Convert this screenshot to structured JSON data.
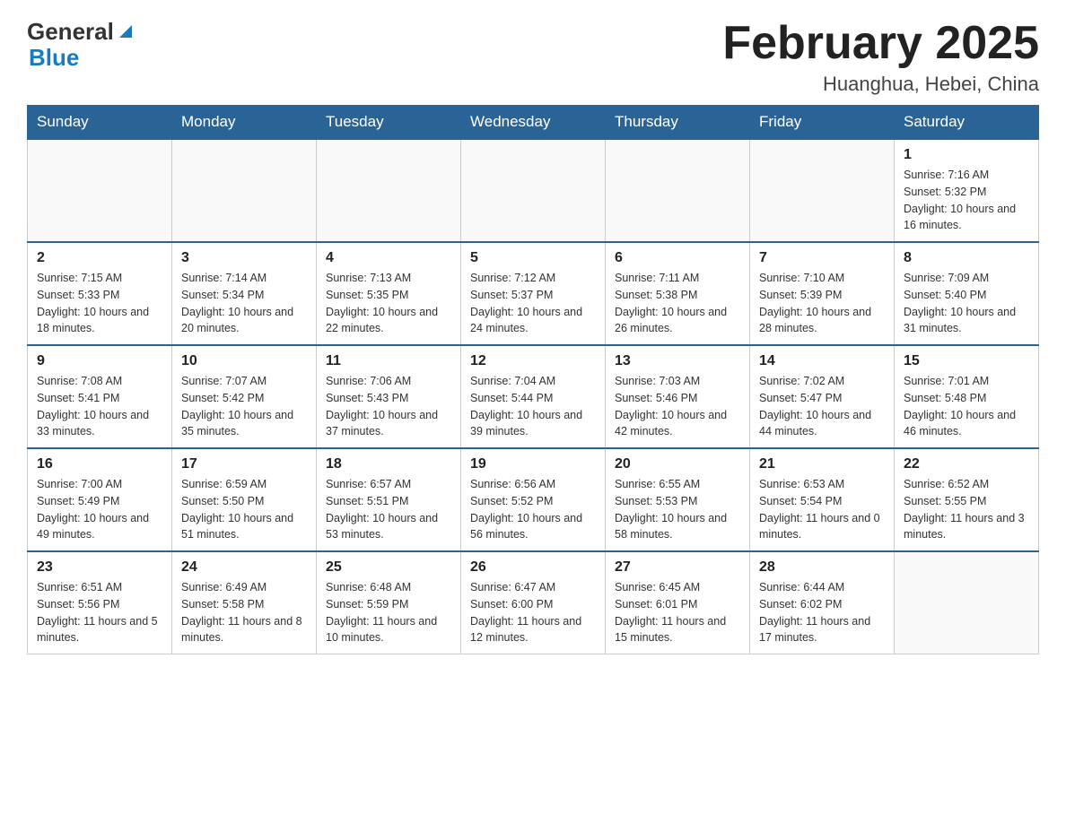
{
  "logo": {
    "general": "General",
    "arrow": "▶",
    "blue": "Blue"
  },
  "title": "February 2025",
  "location": "Huanghua, Hebei, China",
  "days_of_week": [
    "Sunday",
    "Monday",
    "Tuesday",
    "Wednesday",
    "Thursday",
    "Friday",
    "Saturday"
  ],
  "weeks": [
    [
      {
        "day": "",
        "info": ""
      },
      {
        "day": "",
        "info": ""
      },
      {
        "day": "",
        "info": ""
      },
      {
        "day": "",
        "info": ""
      },
      {
        "day": "",
        "info": ""
      },
      {
        "day": "",
        "info": ""
      },
      {
        "day": "1",
        "info": "Sunrise: 7:16 AM\nSunset: 5:32 PM\nDaylight: 10 hours and 16 minutes."
      }
    ],
    [
      {
        "day": "2",
        "info": "Sunrise: 7:15 AM\nSunset: 5:33 PM\nDaylight: 10 hours and 18 minutes."
      },
      {
        "day": "3",
        "info": "Sunrise: 7:14 AM\nSunset: 5:34 PM\nDaylight: 10 hours and 20 minutes."
      },
      {
        "day": "4",
        "info": "Sunrise: 7:13 AM\nSunset: 5:35 PM\nDaylight: 10 hours and 22 minutes."
      },
      {
        "day": "5",
        "info": "Sunrise: 7:12 AM\nSunset: 5:37 PM\nDaylight: 10 hours and 24 minutes."
      },
      {
        "day": "6",
        "info": "Sunrise: 7:11 AM\nSunset: 5:38 PM\nDaylight: 10 hours and 26 minutes."
      },
      {
        "day": "7",
        "info": "Sunrise: 7:10 AM\nSunset: 5:39 PM\nDaylight: 10 hours and 28 minutes."
      },
      {
        "day": "8",
        "info": "Sunrise: 7:09 AM\nSunset: 5:40 PM\nDaylight: 10 hours and 31 minutes."
      }
    ],
    [
      {
        "day": "9",
        "info": "Sunrise: 7:08 AM\nSunset: 5:41 PM\nDaylight: 10 hours and 33 minutes."
      },
      {
        "day": "10",
        "info": "Sunrise: 7:07 AM\nSunset: 5:42 PM\nDaylight: 10 hours and 35 minutes."
      },
      {
        "day": "11",
        "info": "Sunrise: 7:06 AM\nSunset: 5:43 PM\nDaylight: 10 hours and 37 minutes."
      },
      {
        "day": "12",
        "info": "Sunrise: 7:04 AM\nSunset: 5:44 PM\nDaylight: 10 hours and 39 minutes."
      },
      {
        "day": "13",
        "info": "Sunrise: 7:03 AM\nSunset: 5:46 PM\nDaylight: 10 hours and 42 minutes."
      },
      {
        "day": "14",
        "info": "Sunrise: 7:02 AM\nSunset: 5:47 PM\nDaylight: 10 hours and 44 minutes."
      },
      {
        "day": "15",
        "info": "Sunrise: 7:01 AM\nSunset: 5:48 PM\nDaylight: 10 hours and 46 minutes."
      }
    ],
    [
      {
        "day": "16",
        "info": "Sunrise: 7:00 AM\nSunset: 5:49 PM\nDaylight: 10 hours and 49 minutes."
      },
      {
        "day": "17",
        "info": "Sunrise: 6:59 AM\nSunset: 5:50 PM\nDaylight: 10 hours and 51 minutes."
      },
      {
        "day": "18",
        "info": "Sunrise: 6:57 AM\nSunset: 5:51 PM\nDaylight: 10 hours and 53 minutes."
      },
      {
        "day": "19",
        "info": "Sunrise: 6:56 AM\nSunset: 5:52 PM\nDaylight: 10 hours and 56 minutes."
      },
      {
        "day": "20",
        "info": "Sunrise: 6:55 AM\nSunset: 5:53 PM\nDaylight: 10 hours and 58 minutes."
      },
      {
        "day": "21",
        "info": "Sunrise: 6:53 AM\nSunset: 5:54 PM\nDaylight: 11 hours and 0 minutes."
      },
      {
        "day": "22",
        "info": "Sunrise: 6:52 AM\nSunset: 5:55 PM\nDaylight: 11 hours and 3 minutes."
      }
    ],
    [
      {
        "day": "23",
        "info": "Sunrise: 6:51 AM\nSunset: 5:56 PM\nDaylight: 11 hours and 5 minutes."
      },
      {
        "day": "24",
        "info": "Sunrise: 6:49 AM\nSunset: 5:58 PM\nDaylight: 11 hours and 8 minutes."
      },
      {
        "day": "25",
        "info": "Sunrise: 6:48 AM\nSunset: 5:59 PM\nDaylight: 11 hours and 10 minutes."
      },
      {
        "day": "26",
        "info": "Sunrise: 6:47 AM\nSunset: 6:00 PM\nDaylight: 11 hours and 12 minutes."
      },
      {
        "day": "27",
        "info": "Sunrise: 6:45 AM\nSunset: 6:01 PM\nDaylight: 11 hours and 15 minutes."
      },
      {
        "day": "28",
        "info": "Sunrise: 6:44 AM\nSunset: 6:02 PM\nDaylight: 11 hours and 17 minutes."
      },
      {
        "day": "",
        "info": ""
      }
    ]
  ]
}
